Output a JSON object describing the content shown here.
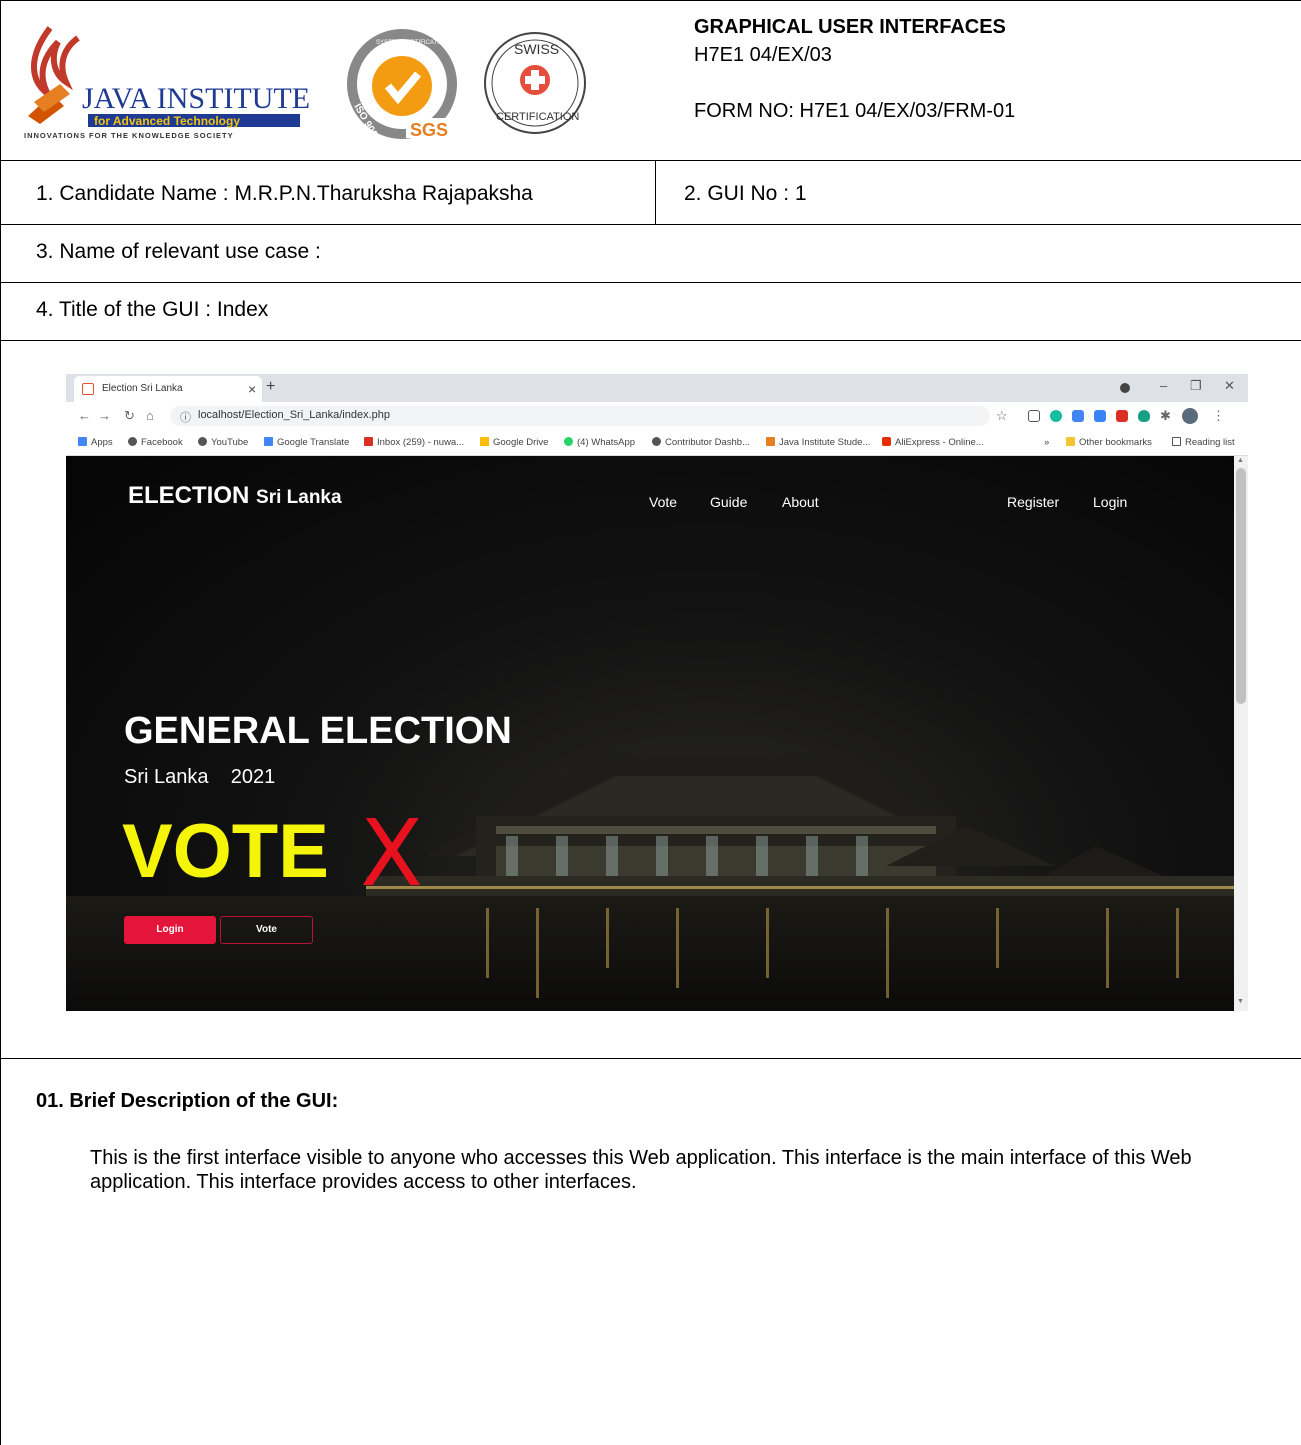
{
  "header": {
    "title": "GRAPHICAL USER INTERFACES",
    "code": "H7E1 04/EX/03",
    "form_no": "FORM NO: H7E1 04/EX/03/FRM-01",
    "logo_java_name": "JAVA INSTITUTE",
    "logo_java_sub": "for Advanced Technology",
    "logo_java_tag": "INNOVATIONS FOR THE KNOWLEDGE SOCIETY",
    "logo_sgs_text": "SGS",
    "logo_sgs_ring": "SYSTEM CERTIFICATION",
    "logo_sgs_iso": "ISO 9001",
    "logo_swiss_top": "SWISS",
    "logo_swiss_bottom": "CERTIFICATION"
  },
  "fields": {
    "candidate": "1. Candidate Name : M.R.P.N.Tharuksha Rajapaksha",
    "gui_no": "2. GUI No : 1",
    "use_case": "3. Name of relevant use case :",
    "gui_title": "4. Title of the GUI : Index"
  },
  "browser": {
    "tab_title": "Election Sri Lanka",
    "url": "localhost/Election_Sri_Lanka/index.php",
    "bookmarks": [
      "Apps",
      "Facebook",
      "YouTube",
      "Google Translate",
      "Inbox (259) - nuwa...",
      "Google Drive",
      "(4) WhatsApp",
      "Contributor Dashb...",
      "Java Institute Stude...",
      "AliExpress - Online...",
      "»",
      "Other bookmarks",
      "Reading list"
    ]
  },
  "site": {
    "brand_main": "ELECTION",
    "brand_sub": "Sri Lanka",
    "nav": [
      "Vote",
      "Guide",
      "About"
    ],
    "nav_right": [
      "Register",
      "Login"
    ],
    "hero_title": "GENERAL ELECTION",
    "hero_country": "Sri Lanka",
    "hero_year": "2021",
    "hero_vote": "VOTE",
    "hero_mark": "X",
    "btn_login": "Login",
    "btn_vote": "Vote"
  },
  "description": {
    "heading": "01. Brief Description of the GUI:",
    "body": "This is the first interface visible to anyone who accesses this Web application. This interface is the main interface of this Web application. This interface provides access to other interfaces."
  }
}
